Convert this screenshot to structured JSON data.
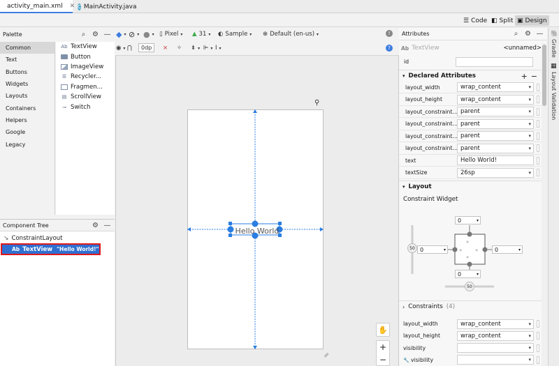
{
  "tabs": [
    {
      "label": "activity_main.xml",
      "icon": "xml-file-icon",
      "active": true
    },
    {
      "label": "MainActivity.java",
      "icon": "java-class-icon",
      "active": false
    }
  ],
  "view_modes": {
    "code": "Code",
    "split": "Split",
    "design": "Design"
  },
  "palette": {
    "title": "Palette",
    "categories": [
      "Common",
      "Text",
      "Buttons",
      "Widgets",
      "Layouts",
      "Containers",
      "Helpers",
      "Google",
      "Legacy"
    ],
    "items": [
      {
        "label": "TextView",
        "icon": "Ab"
      },
      {
        "label": "Button",
        "icon": "btn"
      },
      {
        "label": "ImageView",
        "icon": "img"
      },
      {
        "label": "Recycler...",
        "icon": "list"
      },
      {
        "label": "Fragmen...",
        "icon": "frag"
      },
      {
        "label": "ScrollView",
        "icon": "scroll"
      },
      {
        "label": "Switch",
        "icon": "switch"
      }
    ]
  },
  "component_tree": {
    "title": "Component Tree",
    "root": "ConstraintLayout",
    "child_icon": "Ab",
    "child": "TextView",
    "child_text": "\"Hello World!\""
  },
  "design_toolbar": {
    "device": "Pixel",
    "api": "31",
    "theme": "Sample",
    "locale": "Default (en-us)",
    "margin": "0dp"
  },
  "canvas": {
    "text": "Hello World"
  },
  "zoom": {
    "plus": "+",
    "minus": "−"
  },
  "attributes": {
    "title": "Attributes",
    "widget_icon": "Ab",
    "widget": "TextView",
    "widget_id": "<unnamed>",
    "id_label": "id",
    "id_value": "",
    "declared_title": "Declared Attributes",
    "declared": [
      {
        "name": "layout_width",
        "value": "wrap_content",
        "dropdown": true
      },
      {
        "name": "layout_height",
        "value": "wrap_content",
        "dropdown": true
      },
      {
        "name": "layout_constraint...",
        "value": "parent",
        "dropdown": true
      },
      {
        "name": "layout_constraint...",
        "value": "parent",
        "dropdown": true
      },
      {
        "name": "layout_constraint...",
        "value": "parent",
        "dropdown": true
      },
      {
        "name": "layout_constraint...",
        "value": "parent",
        "dropdown": true
      },
      {
        "name": "text",
        "value": "Hello World!",
        "dropdown": false
      },
      {
        "name": "textSize",
        "value": "26sp",
        "dropdown": true
      }
    ],
    "layout_title": "Layout",
    "constraint_widget_title": "Constraint Widget",
    "margins": {
      "top": "0",
      "left": "0",
      "right": "0",
      "bottom": "0"
    },
    "bias": {
      "vertical": "50",
      "horizontal": "50"
    },
    "constraints_title": "Constraints",
    "constraints_count": "(4)",
    "layout_rows": [
      {
        "name": "layout_width",
        "value": "wrap_content"
      },
      {
        "name": "layout_height",
        "value": "wrap_content"
      },
      {
        "name": "visibility",
        "value": ""
      },
      {
        "name": "visibility",
        "value": "",
        "tool_icon": true
      }
    ]
  },
  "side_tools": {
    "gradle": "Gradle",
    "layout_validation": "Layout Validation"
  },
  "colors": {
    "accent": "#3d7de0",
    "selection": "#2f6fd1",
    "highlight": "#e0191d"
  }
}
